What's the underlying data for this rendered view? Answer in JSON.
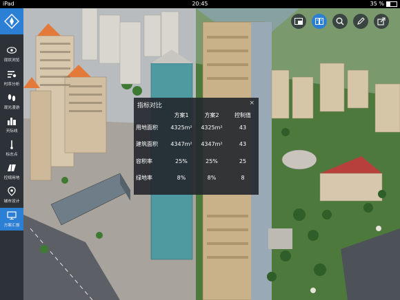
{
  "status_bar": {
    "device": "iPad",
    "time": "20:45",
    "battery": "35 %",
    "battery_level": 0.35
  },
  "sidebar": {
    "items": [
      {
        "label": "现状浏览",
        "icon": "eye-icon"
      },
      {
        "label": "时序分析",
        "icon": "timeline-icon"
      },
      {
        "label": "观光漫游",
        "icon": "footprints-icon"
      },
      {
        "label": "天际线",
        "icon": "skyline-icon"
      },
      {
        "label": "标志点",
        "icon": "landmark-icon"
      },
      {
        "label": "控规用地",
        "icon": "land-use-icon"
      },
      {
        "label": "城市设计",
        "icon": "location-pin-icon"
      },
      {
        "label": "方案汇报",
        "icon": "report-icon",
        "active": true
      }
    ]
  },
  "toolbar": {
    "buttons": [
      {
        "name": "window-icon"
      },
      {
        "name": "compare-icon",
        "active": true
      },
      {
        "name": "search-icon"
      },
      {
        "name": "pen-icon"
      },
      {
        "name": "share-icon"
      }
    ]
  },
  "panel": {
    "title": "指标对比",
    "close": "×",
    "headers": [
      "",
      "方案1",
      "方案2",
      "控制值"
    ],
    "rows": [
      {
        "label": "用地面积",
        "v1": "4325m²",
        "v2": "4325m²",
        "ctrl": "43"
      },
      {
        "label": "建筑面积",
        "v1": "4347m²",
        "v2": "4347m²",
        "ctrl": "43"
      },
      {
        "label": "容积率",
        "v1": "25%",
        "v2": "25%",
        "ctrl": "25"
      },
      {
        "label": "绿地率",
        "v1": "8%",
        "v2": "8%",
        "ctrl": "8"
      }
    ]
  }
}
